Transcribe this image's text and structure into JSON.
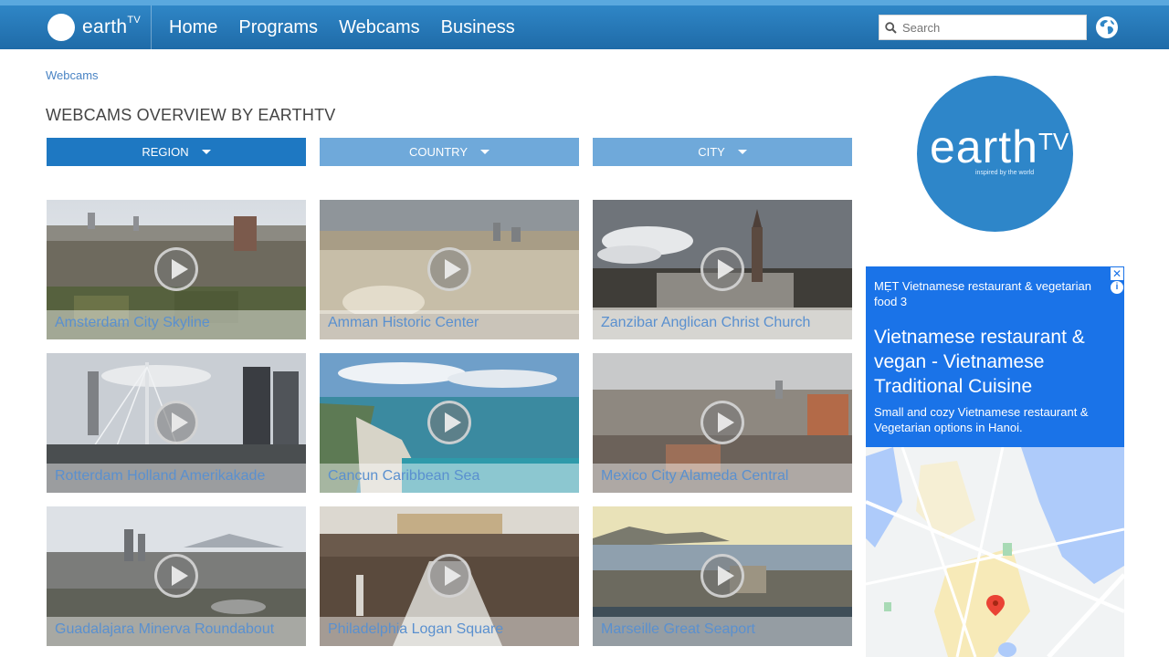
{
  "header": {
    "logo_text": "earth",
    "logo_superscript": "TV",
    "nav": [
      "Home",
      "Programs",
      "Webcams",
      "Business"
    ],
    "search_placeholder": "Search"
  },
  "breadcrumb": "Webcams",
  "page_title": "WEBCAMS OVERVIEW BY EARTHTV",
  "filters": [
    {
      "label": "REGION",
      "color": "#1e78c2"
    },
    {
      "label": "COUNTRY",
      "color": "#6fa9da"
    },
    {
      "label": "CITY",
      "color": "#6fa9da"
    }
  ],
  "webcams": [
    {
      "title": "Amsterdam City Skyline"
    },
    {
      "title": "Amman Historic Center"
    },
    {
      "title": "Zanzibar Anglican Christ Church"
    },
    {
      "title": "Rotterdam Holland Amerikakade"
    },
    {
      "title": "Cancun Caribbean Sea"
    },
    {
      "title": "Mexico City Alameda Central"
    },
    {
      "title": "Guadalajara Minerva Roundabout"
    },
    {
      "title": "Philadelphia Logan Square"
    },
    {
      "title": "Marseille Great Seaport"
    }
  ],
  "sidebar": {
    "logo_text": "earth",
    "logo_superscript": "TV",
    "logo_tagline": "inspired by the world"
  },
  "ad": {
    "advertiser": "MẸT Vietnamese restaurant & vegetarian food 3",
    "headline": "Vietnamese restaurant & vegan - Vietnamese Traditional Cuisine",
    "description": "Small and cozy Vietnamese restaurant & Vegetarian options in Hanoi.",
    "close_icon": "✕",
    "info_icon": "i"
  },
  "colors": {
    "header": "#1f6ba8",
    "accent": "#2e86c9",
    "ad_background": "#1a73e8"
  }
}
